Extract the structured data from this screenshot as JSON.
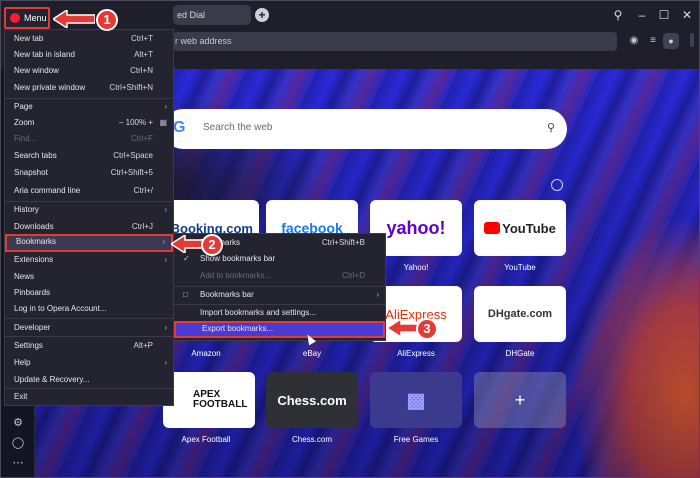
{
  "tab": {
    "title": "ed Dial"
  },
  "address_bar": {
    "placeholder": "r web address"
  },
  "menu_button": {
    "label": "Menu"
  },
  "main_menu": {
    "items": [
      {
        "label": "New tab",
        "shortcut": "Ctrl+T"
      },
      {
        "label": "New tab in island",
        "shortcut": "Alt+T"
      },
      {
        "label": "New window",
        "shortcut": "Ctrl+N"
      },
      {
        "label": "New private window",
        "shortcut": "Ctrl+Shift+N"
      },
      {
        "label": "Page",
        "shortcut": ""
      },
      {
        "label": "Zoom",
        "shortcut": "–  100% +"
      },
      {
        "label": "Find...",
        "shortcut": "Ctrl+F"
      },
      {
        "label": "Search tabs",
        "shortcut": "Ctrl+Space"
      },
      {
        "label": "Snapshot",
        "shortcut": "Ctrl+Shift+5"
      },
      {
        "label": "Aria command line",
        "shortcut": "Ctrl+/"
      },
      {
        "label": "History",
        "shortcut": ""
      },
      {
        "label": "Downloads",
        "shortcut": "Ctrl+J"
      },
      {
        "label": "Bookmarks",
        "shortcut": ""
      },
      {
        "label": "Extensions",
        "shortcut": ""
      },
      {
        "label": "News",
        "shortcut": ""
      },
      {
        "label": "Pinboards",
        "shortcut": ""
      },
      {
        "label": "Log in to Opera Account...",
        "shortcut": ""
      },
      {
        "label": "Developer",
        "shortcut": ""
      },
      {
        "label": "Settings",
        "shortcut": "Alt+P"
      },
      {
        "label": "Help",
        "shortcut": ""
      },
      {
        "label": "Update & Recovery...",
        "shortcut": ""
      },
      {
        "label": "Exit",
        "shortcut": ""
      }
    ]
  },
  "bookmarks_submenu": {
    "items": [
      {
        "label": "Bookmarks",
        "shortcut": "Ctrl+Shift+B"
      },
      {
        "label": "Show bookmarks bar",
        "shortcut": ""
      },
      {
        "label": "Add to bookmarks...",
        "shortcut": "Ctrl+D"
      },
      {
        "label": "Bookmarks bar",
        "shortcut": ""
      },
      {
        "label": "Import bookmarks and settings...",
        "shortcut": ""
      },
      {
        "label": "Export bookmarks...",
        "shortcut": ""
      }
    ]
  },
  "search": {
    "placeholder": "Search the web",
    "logo": "G"
  },
  "speed_dials": [
    {
      "label": "",
      "logo": "Booking.com"
    },
    {
      "label": "",
      "logo": "facebook"
    },
    {
      "label": "Yahoo!",
      "logo": "yahoo!"
    },
    {
      "label": "YouTube",
      "logo": "YouTube"
    },
    {
      "label": "Amazon",
      "logo": ""
    },
    {
      "label": "eBay",
      "logo": ""
    },
    {
      "label": "AliExpress",
      "logo": "AliExpress"
    },
    {
      "label": "DHGate",
      "logo": "DHgate.com"
    },
    {
      "label": "Apex Football",
      "logo": "APEX FOOTBALL"
    },
    {
      "label": "Chess.com",
      "logo": "Chess.com"
    },
    {
      "label": "Free Games",
      "logo": ""
    },
    {
      "label": "",
      "logo": "+"
    }
  ],
  "steps": [
    "1",
    "2",
    "3"
  ],
  "colors": {
    "accent_red": "#e53935",
    "opera_red": "#ff1b2d",
    "menu_bg": "#23242f",
    "highlight": "#4a3bd4"
  }
}
